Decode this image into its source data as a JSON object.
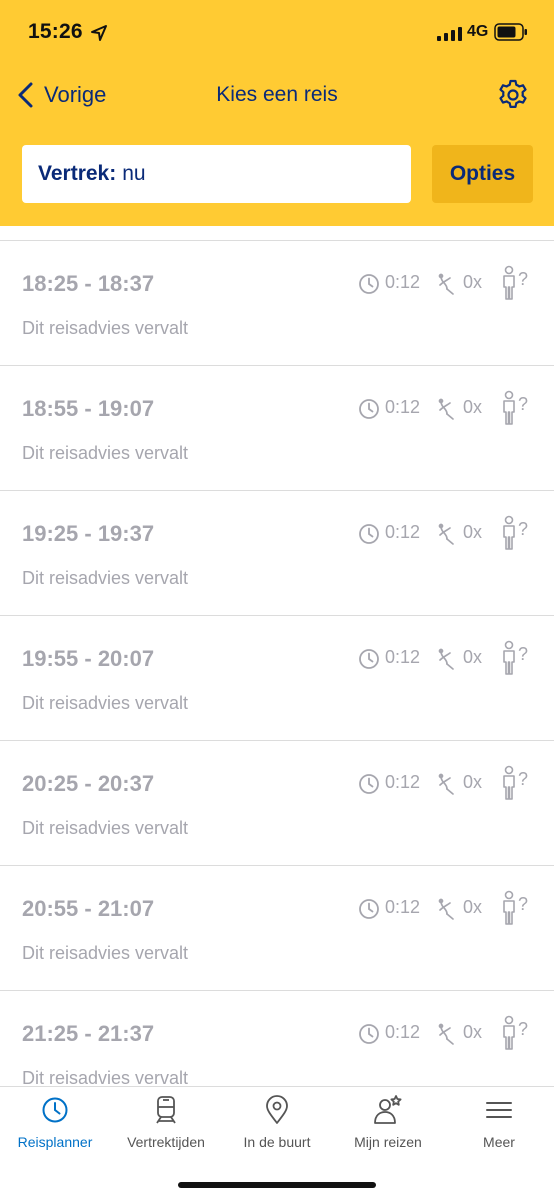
{
  "status_bar": {
    "time": "15:26",
    "network": "4G"
  },
  "nav": {
    "back_label": "Vorige",
    "title": "Kies een reis"
  },
  "search": {
    "departure_label": "Vertrek:",
    "departure_value": "nu",
    "options_label": "Opties"
  },
  "trips": [
    {
      "time_range": "18:25 - 18:37",
      "duration": "0:12",
      "transfers": "0x",
      "crowding": "?",
      "status": "Dit reisadvies vervalt"
    },
    {
      "time_range": "18:55 - 19:07",
      "duration": "0:12",
      "transfers": "0x",
      "crowding": "?",
      "status": "Dit reisadvies vervalt"
    },
    {
      "time_range": "19:25 - 19:37",
      "duration": "0:12",
      "transfers": "0x",
      "crowding": "?",
      "status": "Dit reisadvies vervalt"
    },
    {
      "time_range": "19:55 - 20:07",
      "duration": "0:12",
      "transfers": "0x",
      "crowding": "?",
      "status": "Dit reisadvies vervalt"
    },
    {
      "time_range": "20:25 - 20:37",
      "duration": "0:12",
      "transfers": "0x",
      "crowding": "?",
      "status": "Dit reisadvies vervalt"
    },
    {
      "time_range": "20:55 - 21:07",
      "duration": "0:12",
      "transfers": "0x",
      "crowding": "?",
      "status": "Dit reisadvies vervalt"
    },
    {
      "time_range": "21:25 - 21:37",
      "duration": "0:12",
      "transfers": "0x",
      "crowding": "?",
      "status": "Dit reisadvies vervalt"
    }
  ],
  "tabs": [
    {
      "label": "Reisplanner",
      "icon": "clock-icon",
      "active": true
    },
    {
      "label": "Vertrektijden",
      "icon": "train-icon",
      "active": false
    },
    {
      "label": "In de buurt",
      "icon": "location-pin-icon",
      "active": false
    },
    {
      "label": "Mijn reizen",
      "icon": "user-star-icon",
      "active": false
    },
    {
      "label": "Meer",
      "icon": "menu-icon",
      "active": false
    }
  ],
  "colors": {
    "header": "#FFCB33",
    "options_button": "#F0B51B",
    "navy": "#0A2A78",
    "active_tab": "#0071C7",
    "muted_text": "#A6A6AE"
  }
}
